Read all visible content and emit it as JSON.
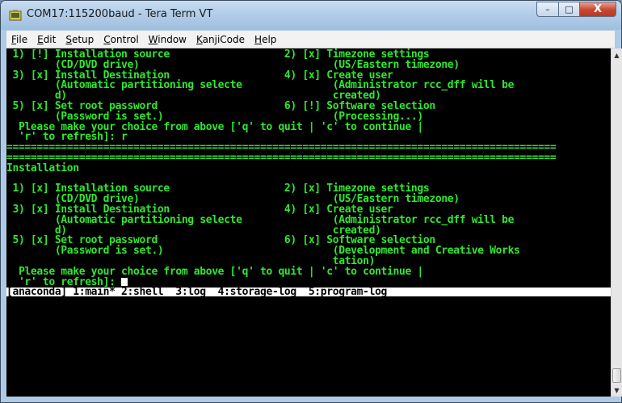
{
  "window": {
    "title": "COM17:115200baud - Tera Term VT",
    "buttons": {
      "minimize": "–",
      "maximize": "□",
      "close": "X"
    }
  },
  "menu": [
    {
      "underlined": "F",
      "rest": "ile"
    },
    {
      "underlined": "E",
      "rest": "dit"
    },
    {
      "underlined": "S",
      "rest": "etup"
    },
    {
      "underlined": "C",
      "rest": "ontrol"
    },
    {
      "underlined": "W",
      "rest": "indow"
    },
    {
      "underlined": "K",
      "rest": "anjiCode"
    },
    {
      "underlined": "H",
      "rest": "elp"
    }
  ],
  "terminal": {
    "text_color": "#2ee82e",
    "lines": [
      " 1) [!] Installation source                   2) [x] Timezone settings",
      "        (CD/DVD drive)                                (US/Eastern timezone)",
      " 3) [x] Install Destination                   4) [x] Create user",
      "        (Automatic partitioning selecte               (Administrator rcc_dff will be",
      "        d)                                            created)",
      " 5) [x] Set root password                     6) [!] Software selection",
      "        (Password is set.)                            (Processing...)",
      "  Please make your choice from above ['q' to quit | 'c' to continue |",
      "  'r' to refresh]: r",
      "===========================================================================================",
      "===========================================================================================",
      "Installation",
      "",
      " 1) [x] Installation source                   2) [x] Timezone settings",
      "        (CD/DVD drive)                                (US/Eastern timezone)",
      " 3) [x] Install Destination                   4) [x] Create user",
      "        (Automatic partitioning selecte               (Administrator rcc_dff will be",
      "        d)                                            created)",
      " 5) [x] Set root password                     6) [x] Software selection",
      "        (Password is set.)                            (Development and Creative Works",
      "                                                      tation)",
      "  Please make your choice from above ['q' to quit | 'c' to continue |",
      "  'r' to refresh]: "
    ],
    "status_bar": "[anaconda] 1:main* 2:shell  3:log  4:storage-log  5:program-log"
  }
}
